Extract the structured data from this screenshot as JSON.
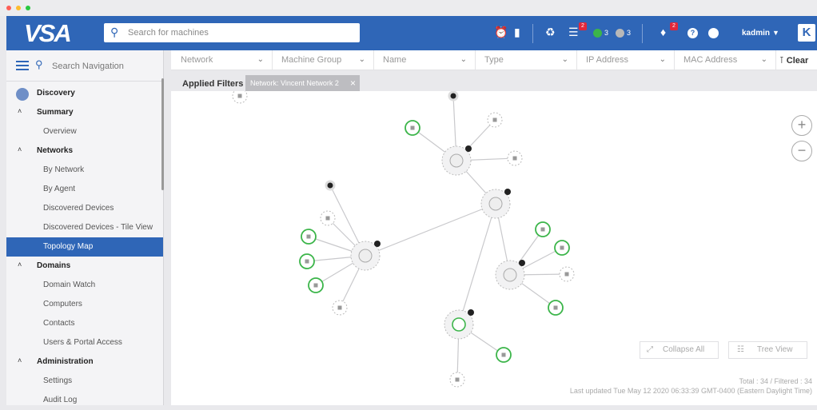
{
  "window": {
    "dots": [
      "#ff5f57",
      "#febc2e",
      "#28c840"
    ]
  },
  "header": {
    "logo": "VSA",
    "search_placeholder": "Search for machines",
    "badge1": "2",
    "count_green": "3",
    "count_gray": "3",
    "badge2": "2",
    "user": "kadmin",
    "brand_icon": "K"
  },
  "sidebar": {
    "search_placeholder": "Search Navigation",
    "items": [
      {
        "label": "Discovery",
        "kind": "module"
      },
      {
        "label": "Summary",
        "kind": "section"
      },
      {
        "label": "Overview",
        "kind": "sub"
      },
      {
        "label": "Networks",
        "kind": "section"
      },
      {
        "label": "By Network",
        "kind": "sub"
      },
      {
        "label": "By Agent",
        "kind": "sub"
      },
      {
        "label": "Discovered Devices",
        "kind": "sub"
      },
      {
        "label": "Discovered Devices - Tile View",
        "kind": "sub"
      },
      {
        "label": "Topology Map",
        "kind": "sub",
        "active": true
      },
      {
        "label": "Domains",
        "kind": "section"
      },
      {
        "label": "Domain Watch",
        "kind": "sub"
      },
      {
        "label": "Computers",
        "kind": "sub"
      },
      {
        "label": "Contacts",
        "kind": "sub"
      },
      {
        "label": "Users & Portal Access",
        "kind": "sub"
      },
      {
        "label": "Administration",
        "kind": "section"
      },
      {
        "label": "Settings",
        "kind": "sub"
      },
      {
        "label": "Audit Log",
        "kind": "sub"
      }
    ]
  },
  "filters": {
    "network": "Network",
    "machine_group": "Machine Group",
    "name": "Name",
    "type": "Type",
    "ip_address": "IP Address",
    "mac_address": "MAC Address",
    "clear": "Clear"
  },
  "applied": {
    "label": "Applied Filters",
    "chip": "Network: Vincent Network 2"
  },
  "canvas": {
    "collapse_all": "Collapse All",
    "tree_view": "Tree View",
    "totals": "Total : 34 / Filtered : 34",
    "last_updated": "Last updated Tue May 12 2020 06:33:39 GMT-0400 (Eastern Daylight Time)"
  },
  "colors": {
    "brand": "#2f66b7",
    "green": "#3cb54a",
    "badge": "#e2273a"
  }
}
